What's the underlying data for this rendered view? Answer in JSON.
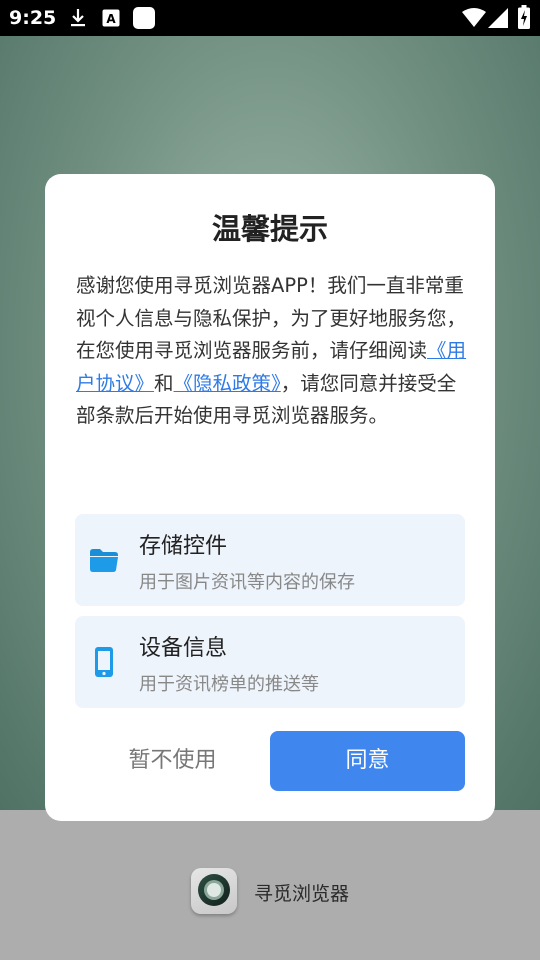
{
  "status_bar": {
    "time": "9:25",
    "icons": [
      "download-icon",
      "font-icon",
      "app-icon",
      "wifi-icon",
      "signal-icon",
      "battery-charging-icon"
    ]
  },
  "dialog": {
    "title": "温馨提示",
    "body_part1": "感谢您使用寻觅浏览器APP！我们一直非常重视个人信息与隐私保护，为了更好地服务您，在您使用寻觅浏览器服务前，请仔细阅读",
    "user_agreement_link": "《用户协议》",
    "body_and": "和",
    "privacy_policy_link": "《隐私政策》",
    "body_part2": "，请您同意并接受全部条款后开始使用寻觅浏览器服务。",
    "permissions": [
      {
        "icon": "folder-icon",
        "title": "存储控件",
        "description": "用于图片资讯等内容的保存"
      },
      {
        "icon": "phone-icon",
        "title": "设备信息",
        "description": "用于资讯榜单的推送等"
      }
    ],
    "decline_label": "暂不使用",
    "agree_label": "同意"
  },
  "splash": {
    "app_name": "寻觅浏览器"
  },
  "colors": {
    "accent": "#3f86ef",
    "link": "#2f7be5",
    "card_bg": "#eef4fc",
    "icon_blue": "#1e9be8"
  }
}
